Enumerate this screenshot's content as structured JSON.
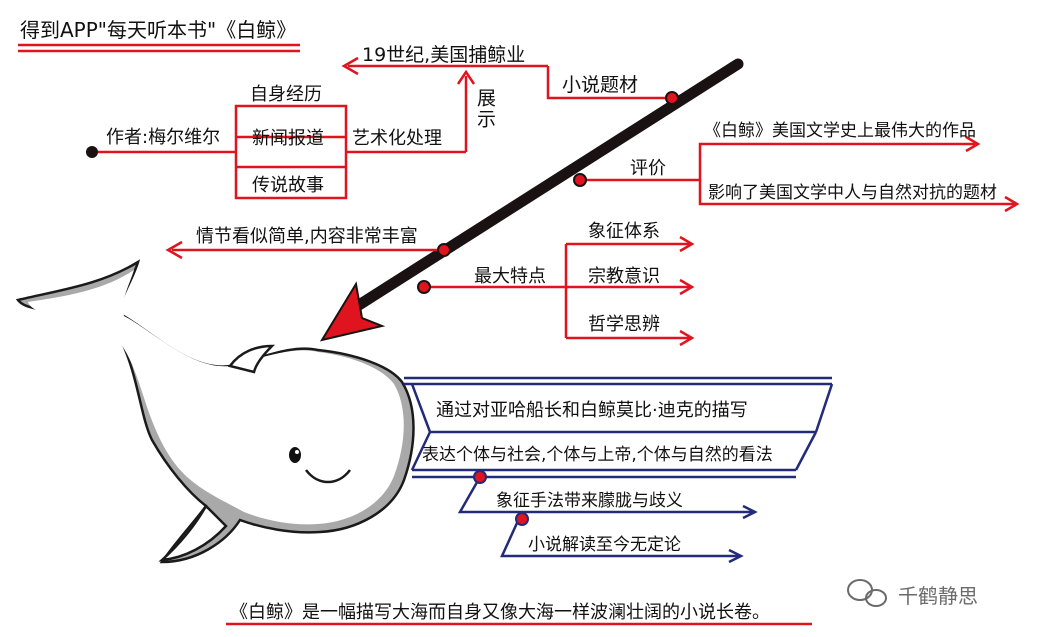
{
  "title": "得到APP\"每天听本书\"《白鲸》",
  "center": {
    "author": "作者:梅尔维尔"
  },
  "source_box": {
    "top": "自身经历",
    "middle": "新闻报道",
    "bottom": "传说故事"
  },
  "process": "艺术化处理",
  "show": "展示",
  "subject_target": "19世纪,美国捕鲸业",
  "subject": "小说题材",
  "evaluation": {
    "label": "评价",
    "items": [
      "《白鲸》美国文学史上最伟大的作品",
      "影响了美国文学中人与自然对抗的题材"
    ]
  },
  "plot": "情节看似简单,内容非常丰富",
  "features": {
    "label": "最大特点",
    "items": [
      "象征体系",
      "宗教意识",
      "哲学思辨"
    ]
  },
  "whale_notes": {
    "banner_top": "通过对亚哈船长和白鲸莫比·迪克的描写",
    "banner_bottom": "表达个体与社会,个体与上帝,个体与自然的看法",
    "item1": "象征手法带来朦胧与歧义",
    "item2": "小说解读至今无定论"
  },
  "conclusion": "《白鲸》是一幅描写大海而自身又像大海一样波澜壮阔的小说长卷。",
  "watermark": "千鹤静思",
  "colors": {
    "red": "#e0141e",
    "navy": "#232a7a",
    "black": "#1a1212",
    "grey": "#a9a9a9"
  }
}
